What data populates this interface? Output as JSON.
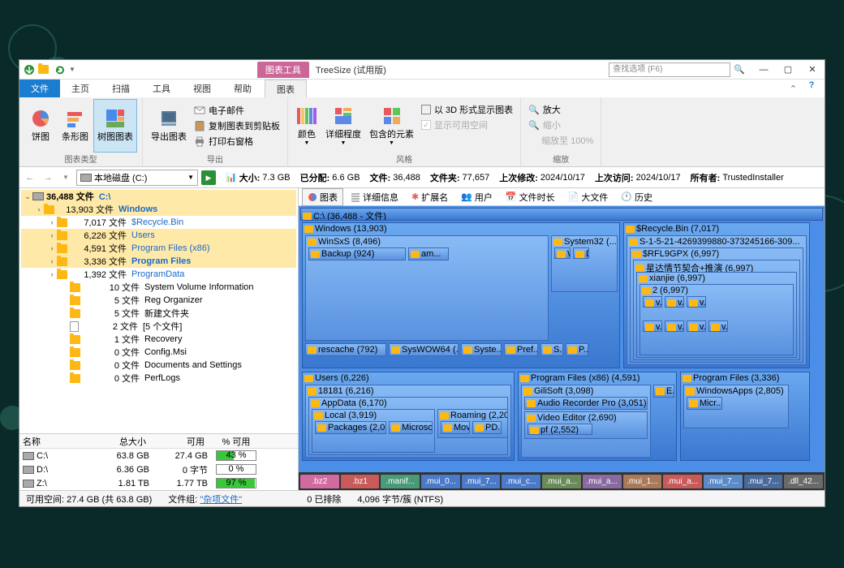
{
  "title_tab": "图表工具",
  "app_title": "TreeSize  (试用版)",
  "search_placeholder": "查找选项 (F6)",
  "ribbon_tabs": {
    "file": "文件",
    "home": "主页",
    "scan": "扫描",
    "tools": "工具",
    "view": "视图",
    "help": "帮助",
    "chart": "图表"
  },
  "ribbon": {
    "chart_types": {
      "label": "图表类型",
      "pie": "饼图",
      "bar": "条形图",
      "tree": "树图图表"
    },
    "export": {
      "label": "导出",
      "export_chart": "导出图表",
      "email": "电子邮件",
      "clipboard": "复制图表到剪贴板",
      "print": "打印右窗格"
    },
    "style": {
      "label": "风格",
      "color": "颜色",
      "detail": "详细程度",
      "contain": "包含的元素",
      "threed": "以 3D 形式显示图表",
      "show_avail": "显示可用空间"
    },
    "zoom": {
      "label": "缩放",
      "in": "放大",
      "out": "缩小",
      "reset": "缩放至 100%"
    }
  },
  "path": "本地磁盘 (C:)",
  "stats": {
    "size_l": "大小:",
    "size_v": "7.3 GB",
    "alloc_l": "已分配:",
    "alloc_v": "6.6 GB",
    "files_l": "文件:",
    "files_v": "36,488",
    "folders_l": "文件夹:",
    "folders_v": "77,657",
    "mod_l": "上次修改:",
    "mod_v": "2024/10/17",
    "acc_l": "上次访问:",
    "acc_v": "2024/10/17",
    "owner_l": "所有者:",
    "owner_v": "TrustedInstaller"
  },
  "tree": {
    "root": {
      "count": "36,488 文件",
      "name": "C:\\"
    },
    "items": [
      {
        "i": 1,
        "exp": true,
        "hl": true,
        "count": "13,903 文件",
        "name": "Windows",
        "bold": true
      },
      {
        "i": 2,
        "count": "7,017 文件",
        "name": "$Recycle.Bin"
      },
      {
        "i": 2,
        "hl": true,
        "count": "6,226 文件",
        "name": "Users"
      },
      {
        "i": 2,
        "hl": true,
        "count": "4,591 文件",
        "name": "Program Files (x86)"
      },
      {
        "i": 2,
        "hl": true,
        "bold": true,
        "count": "3,336 文件",
        "name": "Program Files"
      },
      {
        "i": 2,
        "count": "1,392 文件",
        "name": "ProgramData"
      },
      {
        "i": 3,
        "noexp": true,
        "count": "10 文件",
        "name": "System Volume Information",
        "black": true
      },
      {
        "i": 3,
        "noexp": true,
        "count": "5 文件",
        "name": "Reg Organizer",
        "black": true
      },
      {
        "i": 3,
        "noexp": true,
        "count": "5 文件",
        "name": "新建文件夹",
        "black": true
      },
      {
        "i": 3,
        "noexp": true,
        "file": true,
        "count": "2 文件",
        "name": "[5 个文件]",
        "black": true
      },
      {
        "i": 3,
        "noexp": true,
        "count": "1 文件",
        "name": "Recovery",
        "black": true
      },
      {
        "i": 3,
        "noexp": true,
        "count": "0 文件",
        "name": "Config.Msi",
        "black": true
      },
      {
        "i": 3,
        "noexp": true,
        "count": "0 文件",
        "name": "Documents and Settings",
        "black": true
      },
      {
        "i": 3,
        "noexp": true,
        "count": "0 文件",
        "name": "PerfLogs",
        "black": true
      }
    ]
  },
  "drive_table": {
    "headers": {
      "name": "名称",
      "size": "总大小",
      "avail": "可用",
      "pct": "% 可用"
    },
    "rows": [
      {
        "name": "C:\\",
        "size": "63.8 GB",
        "avail": "27.4 GB",
        "pct": "43 %",
        "fill": 43
      },
      {
        "name": "D:\\",
        "size": "6.36 GB",
        "avail": "0 字节",
        "pct": "0 %",
        "fill": 0
      },
      {
        "name": "Z:\\",
        "size": "1.81 TB",
        "avail": "1.77 TB",
        "pct": "97 %",
        "fill": 97
      }
    ]
  },
  "view_tabs": {
    "chart": "图表",
    "details": "详细信息",
    "ext": "扩展名",
    "users": "用户",
    "age": "文件时长",
    "big": "大文件",
    "history": "历史"
  },
  "treemap": {
    "root": "C:\\ (36,488 - 文件)",
    "windows": "Windows (13,903)",
    "winsxs": "WinSxS (8,496)",
    "backup": "Backup (924)",
    "am": "am...",
    "sys32": "System32 (...",
    "w": "W",
    "d": "D",
    "rescache": "rescache (792)",
    "syswow64": "SysWOW64 (...",
    "syste": "Syste...",
    "pref": "Pref...",
    "s": "S...",
    "p": "P...",
    "recycle": "$Recycle.Bin (7,017)",
    "sid": "S-1-5-21-4269399880-373245166-309...",
    "rfl": "$RFL9GPX (6,997)",
    "xing": "星达情节契合+推演 (6,997)",
    "xianjie": "xianjie (6,997)",
    "two": "2 (6,997)",
    "v": "v...",
    "users": "Users (6,226)",
    "u18181": "18181 (6,216)",
    "appdata": "AppData (6,170)",
    "local": "Local (3,919)",
    "packages": "Packages (2,0...",
    "microsof": "Microsof...",
    "roaming": "Roaming (2,20...",
    "mov": "Mov...",
    "pd": "PD...",
    "pf86": "Program Files (x86) (4,591)",
    "gilisoft": "GiliSoft (3,098)",
    "audiorec": "Audio Recorder Pro (3,051)",
    "videoed": "Video Editor (2,690)",
    "pf_e": "E...",
    "pfsub": "pf (2,552)",
    "pf": "Program Files (3,336)",
    "winapps": "WindowsApps (2,805)",
    "micr": "Micr..."
  },
  "ext_colors": [
    {
      "name": ".bz2",
      "c": "#d06aa0"
    },
    {
      "name": ".bz1",
      "c": "#c85a5a"
    },
    {
      "name": ".manif...",
      "c": "#4a9a7a"
    },
    {
      "name": ".mui_0...",
      "c": "#4a7ac8"
    },
    {
      "name": ".mui_7...",
      "c": "#4a7ac8"
    },
    {
      "name": ".mui_c...",
      "c": "#4a7ac8"
    },
    {
      "name": ".mui_a...",
      "c": "#6a8a5a"
    },
    {
      "name": ".mui_a...",
      "c": "#8a6aa0"
    },
    {
      "name": ".mui_1...",
      "c": "#a87a5a"
    },
    {
      "name": ".mui_a...",
      "c": "#c85a5a"
    },
    {
      "name": ".mui_7...",
      "c": "#5a8ac8"
    },
    {
      "name": ".mui_7...",
      "c": "#4a6a9a"
    },
    {
      "name": ".dll_42...",
      "c": "#6a6a6a"
    }
  ],
  "status": {
    "avail": "可用空间: 27.4 GB  (共 63.8 GB)",
    "filegroup_l": "文件组:",
    "filegroup_v": "\"杂项文件\"",
    "excluded": "0 已排除",
    "cluster": "4,096 字节/簇 (NTFS)"
  }
}
